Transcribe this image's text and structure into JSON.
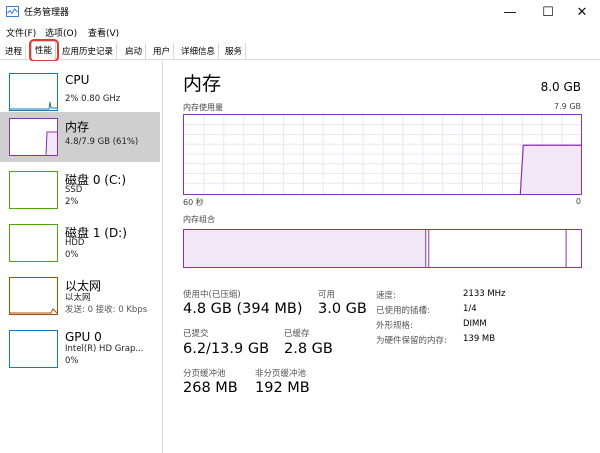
{
  "window": {
    "title": "任务管理器",
    "minimize_glyph": "—",
    "maximize_glyph": "☐",
    "close_glyph": "✕"
  },
  "menu": [
    "文件(F)",
    "选项(O)",
    "查看(V)"
  ],
  "tabs": [
    "进程",
    "性能",
    "应用历史记录",
    "启动",
    "用户",
    "详细信息",
    "服务"
  ],
  "active_tab": "性能",
  "resources": [
    {
      "name": "CPU",
      "line1": "2% 0.80 GHz",
      "line2": "",
      "color": "#117dbb"
    },
    {
      "name": "内存",
      "line1": "4.8/7.9 GB (61%)",
      "line2": "",
      "color": "#8b2fb3"
    },
    {
      "name": "磁盘 0 (C:)",
      "line1": "SSD",
      "line2": "2%",
      "color": "#4da60c"
    },
    {
      "name": "磁盘 1 (D:)",
      "line1": "HDD",
      "line2": "0%",
      "color": "#4da60c"
    },
    {
      "name": "以太网",
      "line1": "以太网",
      "line2": "发送: 0 接收: 0 Kbps",
      "color": "#a74f01"
    },
    {
      "name": "GPU 0",
      "line1": "Intel(R) HD Grap...",
      "line2": "0%",
      "color": "#117dbb"
    }
  ],
  "memory": {
    "title": "内存",
    "total": "8.0 GB",
    "usage_label": "内存使用量",
    "usage_max": "7.9 GB",
    "axis_left": "60 秒",
    "axis_right": "0",
    "composition_label": "内存组合",
    "usage_fraction": 0.61,
    "stats": {
      "in_use_label": "使用中(已压缩)",
      "in_use_value": "4.8 GB (394 MB)",
      "available_label": "可用",
      "available_value": "3.0 GB",
      "committed_label": "已提交",
      "committed_value": "6.2/13.9 GB",
      "cached_label": "已缓存",
      "cached_value": "2.8 GB",
      "paged_pool_label": "分页缓冲池",
      "paged_pool_value": "268 MB",
      "nonpaged_pool_label": "非分页缓冲池",
      "nonpaged_pool_value": "192 MB"
    },
    "specs": {
      "speed_label": "速度:",
      "speed_value": "2133 MHz",
      "slots_label": "已使用的插槽:",
      "slots_value": "1/4",
      "form_label": "外形规格:",
      "form_value": "DIMM",
      "reserved_label": "为硬件保留的内存:",
      "reserved_value": "139 MB"
    }
  },
  "colors": {
    "memory_accent": "#8b2fb3",
    "selected_bg": "#cfcfcf",
    "highlight": "#e03b2e"
  }
}
